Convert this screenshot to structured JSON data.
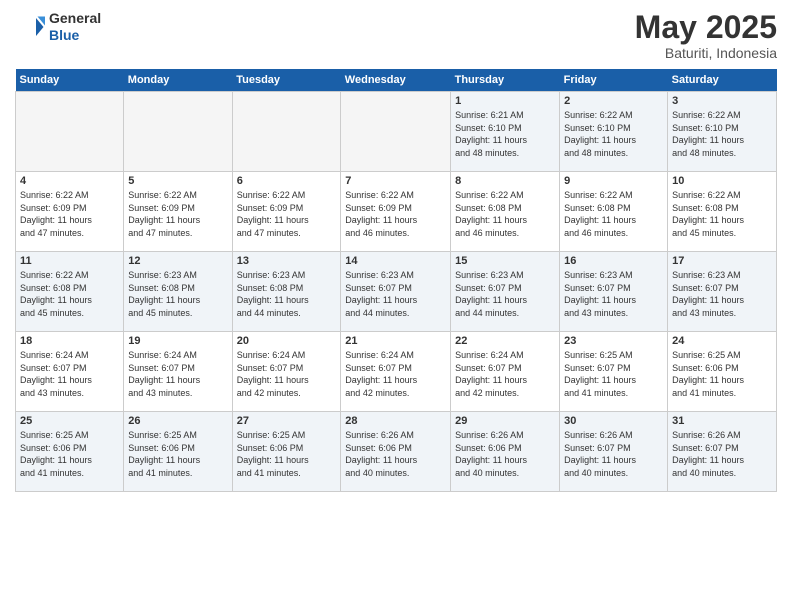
{
  "header": {
    "logo_general": "General",
    "logo_blue": "Blue",
    "month": "May 2025",
    "location": "Baturiti, Indonesia"
  },
  "days_of_week": [
    "Sunday",
    "Monday",
    "Tuesday",
    "Wednesday",
    "Thursday",
    "Friday",
    "Saturday"
  ],
  "weeks": [
    [
      {
        "day": "",
        "info": ""
      },
      {
        "day": "",
        "info": ""
      },
      {
        "day": "",
        "info": ""
      },
      {
        "day": "",
        "info": ""
      },
      {
        "day": "1",
        "info": "Sunrise: 6:21 AM\nSunset: 6:10 PM\nDaylight: 11 hours\nand 48 minutes."
      },
      {
        "day": "2",
        "info": "Sunrise: 6:22 AM\nSunset: 6:10 PM\nDaylight: 11 hours\nand 48 minutes."
      },
      {
        "day": "3",
        "info": "Sunrise: 6:22 AM\nSunset: 6:10 PM\nDaylight: 11 hours\nand 48 minutes."
      }
    ],
    [
      {
        "day": "4",
        "info": "Sunrise: 6:22 AM\nSunset: 6:09 PM\nDaylight: 11 hours\nand 47 minutes."
      },
      {
        "day": "5",
        "info": "Sunrise: 6:22 AM\nSunset: 6:09 PM\nDaylight: 11 hours\nand 47 minutes."
      },
      {
        "day": "6",
        "info": "Sunrise: 6:22 AM\nSunset: 6:09 PM\nDaylight: 11 hours\nand 47 minutes."
      },
      {
        "day": "7",
        "info": "Sunrise: 6:22 AM\nSunset: 6:09 PM\nDaylight: 11 hours\nand 46 minutes."
      },
      {
        "day": "8",
        "info": "Sunrise: 6:22 AM\nSunset: 6:08 PM\nDaylight: 11 hours\nand 46 minutes."
      },
      {
        "day": "9",
        "info": "Sunrise: 6:22 AM\nSunset: 6:08 PM\nDaylight: 11 hours\nand 46 minutes."
      },
      {
        "day": "10",
        "info": "Sunrise: 6:22 AM\nSunset: 6:08 PM\nDaylight: 11 hours\nand 45 minutes."
      }
    ],
    [
      {
        "day": "11",
        "info": "Sunrise: 6:22 AM\nSunset: 6:08 PM\nDaylight: 11 hours\nand 45 minutes."
      },
      {
        "day": "12",
        "info": "Sunrise: 6:23 AM\nSunset: 6:08 PM\nDaylight: 11 hours\nand 45 minutes."
      },
      {
        "day": "13",
        "info": "Sunrise: 6:23 AM\nSunset: 6:08 PM\nDaylight: 11 hours\nand 44 minutes."
      },
      {
        "day": "14",
        "info": "Sunrise: 6:23 AM\nSunset: 6:07 PM\nDaylight: 11 hours\nand 44 minutes."
      },
      {
        "day": "15",
        "info": "Sunrise: 6:23 AM\nSunset: 6:07 PM\nDaylight: 11 hours\nand 44 minutes."
      },
      {
        "day": "16",
        "info": "Sunrise: 6:23 AM\nSunset: 6:07 PM\nDaylight: 11 hours\nand 43 minutes."
      },
      {
        "day": "17",
        "info": "Sunrise: 6:23 AM\nSunset: 6:07 PM\nDaylight: 11 hours\nand 43 minutes."
      }
    ],
    [
      {
        "day": "18",
        "info": "Sunrise: 6:24 AM\nSunset: 6:07 PM\nDaylight: 11 hours\nand 43 minutes."
      },
      {
        "day": "19",
        "info": "Sunrise: 6:24 AM\nSunset: 6:07 PM\nDaylight: 11 hours\nand 43 minutes."
      },
      {
        "day": "20",
        "info": "Sunrise: 6:24 AM\nSunset: 6:07 PM\nDaylight: 11 hours\nand 42 minutes."
      },
      {
        "day": "21",
        "info": "Sunrise: 6:24 AM\nSunset: 6:07 PM\nDaylight: 11 hours\nand 42 minutes."
      },
      {
        "day": "22",
        "info": "Sunrise: 6:24 AM\nSunset: 6:07 PM\nDaylight: 11 hours\nand 42 minutes."
      },
      {
        "day": "23",
        "info": "Sunrise: 6:25 AM\nSunset: 6:07 PM\nDaylight: 11 hours\nand 41 minutes."
      },
      {
        "day": "24",
        "info": "Sunrise: 6:25 AM\nSunset: 6:06 PM\nDaylight: 11 hours\nand 41 minutes."
      }
    ],
    [
      {
        "day": "25",
        "info": "Sunrise: 6:25 AM\nSunset: 6:06 PM\nDaylight: 11 hours\nand 41 minutes."
      },
      {
        "day": "26",
        "info": "Sunrise: 6:25 AM\nSunset: 6:06 PM\nDaylight: 11 hours\nand 41 minutes."
      },
      {
        "day": "27",
        "info": "Sunrise: 6:25 AM\nSunset: 6:06 PM\nDaylight: 11 hours\nand 41 minutes."
      },
      {
        "day": "28",
        "info": "Sunrise: 6:26 AM\nSunset: 6:06 PM\nDaylight: 11 hours\nand 40 minutes."
      },
      {
        "day": "29",
        "info": "Sunrise: 6:26 AM\nSunset: 6:06 PM\nDaylight: 11 hours\nand 40 minutes."
      },
      {
        "day": "30",
        "info": "Sunrise: 6:26 AM\nSunset: 6:07 PM\nDaylight: 11 hours\nand 40 minutes."
      },
      {
        "day": "31",
        "info": "Sunrise: 6:26 AM\nSunset: 6:07 PM\nDaylight: 11 hours\nand 40 minutes."
      }
    ]
  ]
}
